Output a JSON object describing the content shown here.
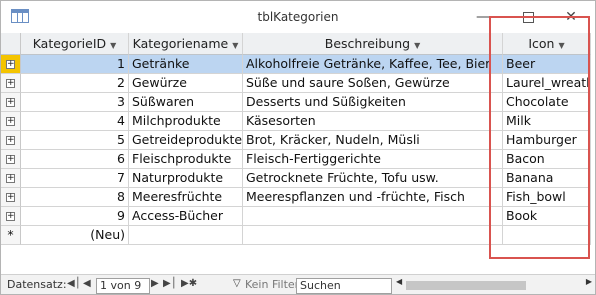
{
  "window": {
    "title": "tblKategorien"
  },
  "columns": [
    {
      "label": "KategorieID"
    },
    {
      "label": "Kategoriename"
    },
    {
      "label": "Beschreibung"
    },
    {
      "label": "Icon"
    }
  ],
  "rows": [
    {
      "id": "1",
      "name": "Getränke",
      "desc": "Alkoholfreie Getränke, Kaffee, Tee, Bier",
      "icon": "Beer"
    },
    {
      "id": "2",
      "name": "Gewürze",
      "desc": "Süße und saure Soßen, Gewürze",
      "icon": "Laurel_wreath"
    },
    {
      "id": "3",
      "name": "Süßwaren",
      "desc": "Desserts und Süßigkeiten",
      "icon": "Chocolate"
    },
    {
      "id": "4",
      "name": "Milchprodukte",
      "desc": "Käsesorten",
      "icon": "Milk"
    },
    {
      "id": "5",
      "name": "Getreideprodukte",
      "desc": "Brot, Kräcker, Nudeln, Müsli",
      "icon": "Hamburger"
    },
    {
      "id": "6",
      "name": "Fleischprodukte",
      "desc": "Fleisch-Fertiggerichte",
      "icon": "Bacon"
    },
    {
      "id": "7",
      "name": "Naturprodukte",
      "desc": "Getrocknete Früchte, Tofu usw.",
      "icon": "Banana"
    },
    {
      "id": "8",
      "name": "Meeresfrüchte",
      "desc": "Meerespflanzen und -früchte, Fisch",
      "icon": "Fish_bowl"
    },
    {
      "id": "9",
      "name": "Access-Bücher",
      "desc": "",
      "icon": "Book"
    }
  ],
  "new_row": {
    "id": "(Neu)",
    "marker": "*"
  },
  "status": {
    "label": "Datensatz:",
    "position": "1 von 9",
    "filter": "Kein Filter",
    "search": "Suchen"
  },
  "colors": {
    "accent_highlight": "#f4c400",
    "selection": "#bcd5f1",
    "red_box": "#d9534f"
  }
}
